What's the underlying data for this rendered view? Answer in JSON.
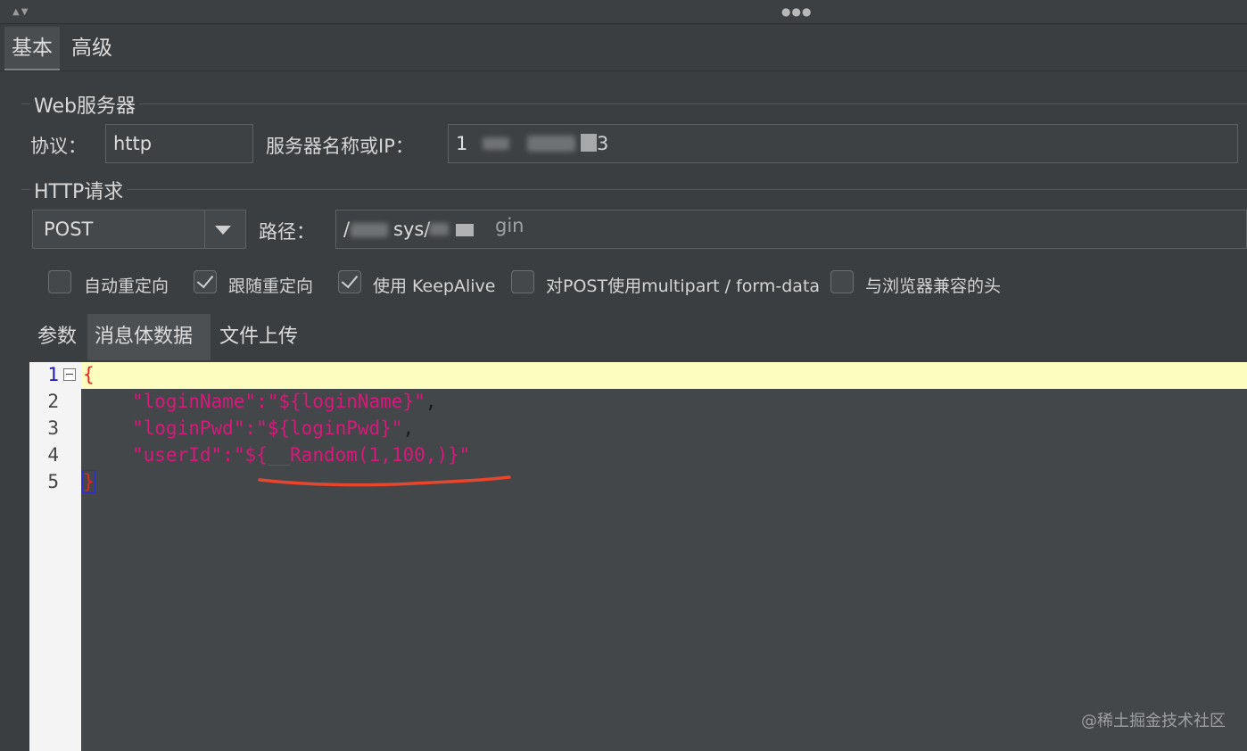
{
  "tabs": [
    "基本",
    "高级"
  ],
  "web_server": {
    "title": "Web服务器",
    "protocol_label": "协议：",
    "protocol_value": "http",
    "server_label": "服务器名称或IP：",
    "server_value_visible": "1",
    "server_value_tail": "3"
  },
  "http_request": {
    "title": "HTTP请求",
    "method": "POST",
    "path_label": "路径：",
    "path_visible": "/",
    "path_mid": "sys/",
    "path_tail": "gin"
  },
  "options": [
    {
      "label": "自动重定向",
      "checked": false
    },
    {
      "label": "跟随重定向",
      "checked": true
    },
    {
      "label": "使用 KeepAlive",
      "checked": true
    },
    {
      "label": "对POST使用multipart / form-data",
      "checked": false
    },
    {
      "label": "与浏览器兼容的头",
      "checked": false
    }
  ],
  "subtabs": [
    "参数",
    "消息体数据",
    "文件上传"
  ],
  "editor": {
    "line_numbers": [
      "1",
      "2",
      "3",
      "4",
      "5"
    ],
    "lines": [
      {
        "open": "{"
      },
      {
        "key": "\"loginName\"",
        "colon": ":",
        "val": "\"${loginName}\"",
        "comma": ","
      },
      {
        "key": "\"loginPwd\"",
        "colon": ":",
        "val": "\"${loginPwd}\"",
        "comma": ","
      },
      {
        "key": "\"userId\"",
        "colon": ":",
        "val": "\"${__Random(1,100,)}\""
      },
      {
        "close": "}"
      }
    ],
    "highlight_color": "#e8452c"
  },
  "watermark": "@稀土掘金技术社区"
}
